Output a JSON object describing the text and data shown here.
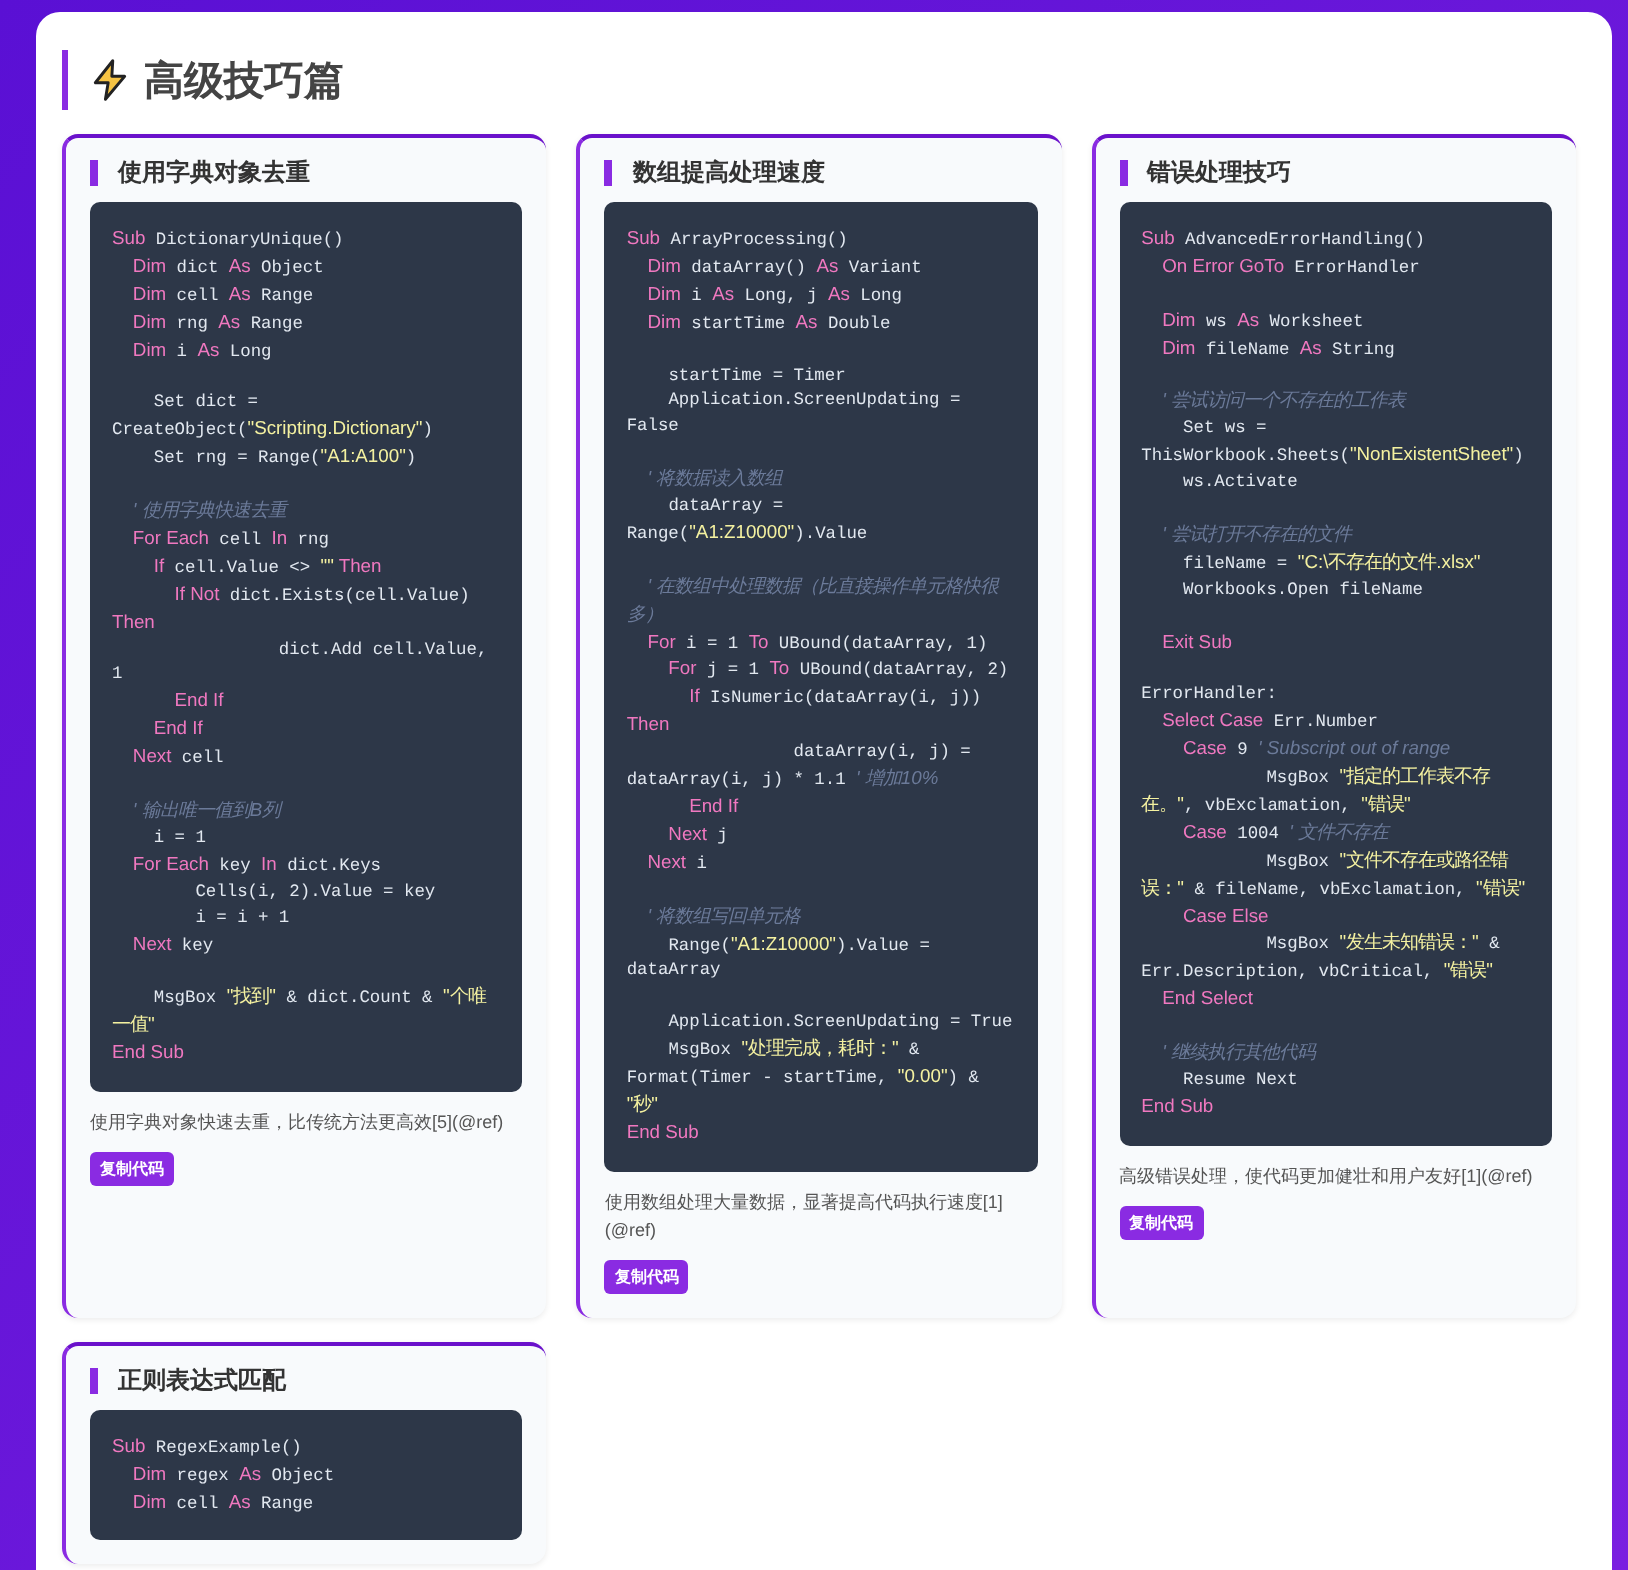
{
  "section": {
    "title": "高级技巧篇"
  },
  "cards": [
    {
      "title": "使用字典对象去重",
      "code": [
        {
          "kind": "code",
          "tokens": [
            {
              "kind": "kw",
              "text": "Sub"
            },
            {
              "kind": "text",
              "text": " DictionaryUnique()"
            }
          ]
        },
        {
          "kind": "code",
          "tokens": [
            {
              "kind": "kw",
              "text": "    Dim"
            },
            {
              "kind": "text",
              "text": " dict "
            },
            {
              "kind": "kw",
              "text": "As"
            },
            {
              "kind": "text",
              "text": " Object"
            }
          ]
        },
        {
          "kind": "code",
          "tokens": [
            {
              "kind": "kw",
              "text": "    Dim"
            },
            {
              "kind": "text",
              "text": " cell "
            },
            {
              "kind": "kw",
              "text": "As"
            },
            {
              "kind": "text",
              "text": " Range"
            }
          ]
        },
        {
          "kind": "code",
          "tokens": [
            {
              "kind": "kw",
              "text": "    Dim"
            },
            {
              "kind": "text",
              "text": " rng "
            },
            {
              "kind": "kw",
              "text": "As"
            },
            {
              "kind": "text",
              "text": " Range"
            }
          ]
        },
        {
          "kind": "code",
          "tokens": [
            {
              "kind": "kw",
              "text": "    Dim"
            },
            {
              "kind": "text",
              "text": " i "
            },
            {
              "kind": "kw",
              "text": "As"
            },
            {
              "kind": "text",
              "text": " Long"
            }
          ]
        },
        {
          "kind": "blank"
        },
        {
          "kind": "code",
          "tokens": [
            {
              "kind": "text",
              "text": "    Set dict = CreateObject("
            },
            {
              "kind": "str",
              "text": "\"Scripting.Dictionary\""
            },
            {
              "kind": "text",
              "text": ")"
            }
          ]
        },
        {
          "kind": "code",
          "tokens": [
            {
              "kind": "text",
              "text": "    Set rng = Range("
            },
            {
              "kind": "str",
              "text": "\"A1:A100\""
            },
            {
              "kind": "text",
              "text": ")"
            }
          ]
        },
        {
          "kind": "blank"
        },
        {
          "kind": "code",
          "tokens": [
            {
              "kind": "comment",
              "text": "    ' 使用字典快速去重"
            }
          ]
        },
        {
          "kind": "code",
          "tokens": [
            {
              "kind": "kw",
              "text": "    For Each"
            },
            {
              "kind": "text",
              "text": " cell "
            },
            {
              "kind": "kw",
              "text": "In"
            },
            {
              "kind": "text",
              "text": " rng"
            }
          ]
        },
        {
          "kind": "code",
          "tokens": [
            {
              "kind": "kw",
              "text": "        If"
            },
            {
              "kind": "text",
              "text": " cell.Value <> "
            },
            {
              "kind": "str",
              "text": "\"\""
            },
            {
              "kind": "kw",
              "text": " Then"
            }
          ]
        },
        {
          "kind": "code",
          "tokens": [
            {
              "kind": "kw",
              "text": "            If Not"
            },
            {
              "kind": "text",
              "text": " dict.Exists(cell.Value) "
            },
            {
              "kind": "kw",
              "text": "Then"
            }
          ]
        },
        {
          "kind": "code",
          "tokens": [
            {
              "kind": "text",
              "text": "                dict.Add cell.Value, 1"
            }
          ]
        },
        {
          "kind": "code",
          "tokens": [
            {
              "kind": "kw",
              "text": "            End If"
            }
          ]
        },
        {
          "kind": "code",
          "tokens": [
            {
              "kind": "kw",
              "text": "        End If"
            }
          ]
        },
        {
          "kind": "code",
          "tokens": [
            {
              "kind": "kw",
              "text": "    Next"
            },
            {
              "kind": "text",
              "text": " cell"
            }
          ]
        },
        {
          "kind": "blank"
        },
        {
          "kind": "code",
          "tokens": [
            {
              "kind": "comment",
              "text": "    ' 输出唯一值到B列"
            }
          ]
        },
        {
          "kind": "code",
          "tokens": [
            {
              "kind": "text",
              "text": "    i = 1"
            }
          ]
        },
        {
          "kind": "code",
          "tokens": [
            {
              "kind": "kw",
              "text": "    For Each"
            },
            {
              "kind": "text",
              "text": " key "
            },
            {
              "kind": "kw",
              "text": "In"
            },
            {
              "kind": "text",
              "text": " dict.Keys"
            }
          ]
        },
        {
          "kind": "code",
          "tokens": [
            {
              "kind": "text",
              "text": "        Cells(i, 2).Value = key"
            }
          ]
        },
        {
          "kind": "code",
          "tokens": [
            {
              "kind": "text",
              "text": "        i = i + 1"
            }
          ]
        },
        {
          "kind": "code",
          "tokens": [
            {
              "kind": "kw",
              "text": "    Next"
            },
            {
              "kind": "text",
              "text": " key"
            }
          ]
        },
        {
          "kind": "blank"
        },
        {
          "kind": "code",
          "tokens": [
            {
              "kind": "text",
              "text": "    MsgBox "
            },
            {
              "kind": "str",
              "text": "\"找到\""
            },
            {
              "kind": "text",
              "text": " & dict.Count & "
            },
            {
              "kind": "str",
              "text": "\"个唯一值\""
            }
          ]
        },
        {
          "kind": "code",
          "tokens": [
            {
              "kind": "kw",
              "text": "End Sub"
            }
          ]
        }
      ],
      "description": "使用字典对象快速去重，比传统方法更高效[5](@ref)",
      "button": "复制代码"
    },
    {
      "title": "数组提高处理速度",
      "code": [
        {
          "kind": "code",
          "tokens": [
            {
              "kind": "kw",
              "text": "Sub"
            },
            {
              "kind": "text",
              "text": " ArrayProcessing()"
            }
          ]
        },
        {
          "kind": "code",
          "tokens": [
            {
              "kind": "kw",
              "text": "    Dim"
            },
            {
              "kind": "text",
              "text": " dataArray() "
            },
            {
              "kind": "kw",
              "text": "As"
            },
            {
              "kind": "text",
              "text": " Variant"
            }
          ]
        },
        {
          "kind": "code",
          "tokens": [
            {
              "kind": "kw",
              "text": "    Dim"
            },
            {
              "kind": "text",
              "text": " i "
            },
            {
              "kind": "kw",
              "text": "As"
            },
            {
              "kind": "text",
              "text": " Long, j "
            },
            {
              "kind": "kw",
              "text": "As"
            },
            {
              "kind": "text",
              "text": " Long"
            }
          ]
        },
        {
          "kind": "code",
          "tokens": [
            {
              "kind": "kw",
              "text": "    Dim"
            },
            {
              "kind": "text",
              "text": " startTime "
            },
            {
              "kind": "kw",
              "text": "As"
            },
            {
              "kind": "text",
              "text": " Double"
            }
          ]
        },
        {
          "kind": "blank"
        },
        {
          "kind": "code",
          "tokens": [
            {
              "kind": "text",
              "text": "    startTime = Timer"
            }
          ]
        },
        {
          "kind": "code",
          "tokens": [
            {
              "kind": "text",
              "text": "    Application.ScreenUpdating = False"
            }
          ]
        },
        {
          "kind": "blank"
        },
        {
          "kind": "code",
          "tokens": [
            {
              "kind": "comment",
              "text": "    ' 将数据读入数组"
            }
          ]
        },
        {
          "kind": "code",
          "tokens": [
            {
              "kind": "text",
              "text": "    dataArray = Range("
            },
            {
              "kind": "str",
              "text": "\"A1:Z10000\""
            },
            {
              "kind": "text",
              "text": ").Value"
            }
          ]
        },
        {
          "kind": "blank"
        },
        {
          "kind": "code",
          "tokens": [
            {
              "kind": "comment",
              "text": "    ' 在数组中处理数据（比直接操作单元格快很多）"
            }
          ]
        },
        {
          "kind": "code",
          "tokens": [
            {
              "kind": "kw",
              "text": "    For"
            },
            {
              "kind": "text",
              "text": " i = 1 "
            },
            {
              "kind": "kw",
              "text": "To"
            },
            {
              "kind": "text",
              "text": " UBound(dataArray, 1)"
            }
          ]
        },
        {
          "kind": "code",
          "tokens": [
            {
              "kind": "kw",
              "text": "        For"
            },
            {
              "kind": "text",
              "text": " j = 1 "
            },
            {
              "kind": "kw",
              "text": "To"
            },
            {
              "kind": "text",
              "text": " UBound(dataArray, 2)"
            }
          ]
        },
        {
          "kind": "code",
          "tokens": [
            {
              "kind": "kw",
              "text": "            If"
            },
            {
              "kind": "text",
              "text": " IsNumeric(dataArray(i, j)) "
            },
            {
              "kind": "kw",
              "text": "Then"
            }
          ]
        },
        {
          "kind": "code",
          "tokens": [
            {
              "kind": "text",
              "text": "                dataArray(i, j) = dataArray(i, j) * 1.1 "
            },
            {
              "kind": "comment",
              "text": "' 增加10%"
            }
          ]
        },
        {
          "kind": "code",
          "tokens": [
            {
              "kind": "kw",
              "text": "            End If"
            }
          ]
        },
        {
          "kind": "code",
          "tokens": [
            {
              "kind": "kw",
              "text": "        Next"
            },
            {
              "kind": "text",
              "text": " j"
            }
          ]
        },
        {
          "kind": "code",
          "tokens": [
            {
              "kind": "kw",
              "text": "    Next"
            },
            {
              "kind": "text",
              "text": " i"
            }
          ]
        },
        {
          "kind": "blank"
        },
        {
          "kind": "code",
          "tokens": [
            {
              "kind": "comment",
              "text": "    ' 将数组写回单元格"
            }
          ]
        },
        {
          "kind": "code",
          "tokens": [
            {
              "kind": "text",
              "text": "    Range("
            },
            {
              "kind": "str",
              "text": "\"A1:Z10000\""
            },
            {
              "kind": "text",
              "text": ").Value = dataArray"
            }
          ]
        },
        {
          "kind": "blank"
        },
        {
          "kind": "code",
          "tokens": [
            {
              "kind": "text",
              "text": "    Application.ScreenUpdating = True"
            }
          ]
        },
        {
          "kind": "code",
          "tokens": [
            {
              "kind": "text",
              "text": "    MsgBox "
            },
            {
              "kind": "str",
              "text": "\"处理完成，耗时：\""
            },
            {
              "kind": "text",
              "text": " & Format(Timer - startTime, "
            },
            {
              "kind": "str",
              "text": "\"0.00\""
            },
            {
              "kind": "text",
              "text": ") & "
            },
            {
              "kind": "str",
              "text": "\"秒\""
            }
          ]
        },
        {
          "kind": "code",
          "tokens": [
            {
              "kind": "kw",
              "text": "End Sub"
            }
          ]
        }
      ],
      "description": "使用数组处理大量数据，显著提高代码执行速度[1](@ref)",
      "button": "复制代码"
    },
    {
      "title": "错误处理技巧",
      "code": [
        {
          "kind": "code",
          "tokens": [
            {
              "kind": "kw",
              "text": "Sub"
            },
            {
              "kind": "text",
              "text": " AdvancedErrorHandling()"
            }
          ]
        },
        {
          "kind": "code",
          "tokens": [
            {
              "kind": "kw",
              "text": "    On Error GoTo"
            },
            {
              "kind": "text",
              "text": " ErrorHandler"
            }
          ]
        },
        {
          "kind": "blank"
        },
        {
          "kind": "code",
          "tokens": [
            {
              "kind": "kw",
              "text": "    Dim"
            },
            {
              "kind": "text",
              "text": " ws "
            },
            {
              "kind": "kw",
              "text": "As"
            },
            {
              "kind": "text",
              "text": " Worksheet"
            }
          ]
        },
        {
          "kind": "code",
          "tokens": [
            {
              "kind": "kw",
              "text": "    Dim"
            },
            {
              "kind": "text",
              "text": " fileName "
            },
            {
              "kind": "kw",
              "text": "As"
            },
            {
              "kind": "text",
              "text": " String"
            }
          ]
        },
        {
          "kind": "blank"
        },
        {
          "kind": "code",
          "tokens": [
            {
              "kind": "comment",
              "text": "    ' 尝试访问一个不存在的工作表"
            }
          ]
        },
        {
          "kind": "code",
          "tokens": [
            {
              "kind": "text",
              "text": "    Set ws = ThisWorkbook.Sheets("
            },
            {
              "kind": "str",
              "text": "\"NonExistentSheet\""
            },
            {
              "kind": "text",
              "text": ")"
            }
          ]
        },
        {
          "kind": "code",
          "tokens": [
            {
              "kind": "text",
              "text": "    ws.Activate"
            }
          ]
        },
        {
          "kind": "blank"
        },
        {
          "kind": "code",
          "tokens": [
            {
              "kind": "comment",
              "text": "    ' 尝试打开不存在的文件"
            }
          ]
        },
        {
          "kind": "code",
          "tokens": [
            {
              "kind": "text",
              "text": "    fileName = "
            },
            {
              "kind": "str",
              "text": "\"C:\\不存在的文件.xlsx\""
            }
          ]
        },
        {
          "kind": "code",
          "tokens": [
            {
              "kind": "text",
              "text": "    Workbooks.Open fileName"
            }
          ]
        },
        {
          "kind": "blank"
        },
        {
          "kind": "code",
          "tokens": [
            {
              "kind": "kw",
              "text": "    Exit Sub"
            }
          ]
        },
        {
          "kind": "blank"
        },
        {
          "kind": "code",
          "tokens": [
            {
              "kind": "text",
              "text": "ErrorHandler:"
            }
          ]
        },
        {
          "kind": "code",
          "tokens": [
            {
              "kind": "kw",
              "text": "    Select Case"
            },
            {
              "kind": "text",
              "text": " Err.Number"
            }
          ]
        },
        {
          "kind": "code",
          "tokens": [
            {
              "kind": "kw",
              "text": "        Case"
            },
            {
              "kind": "text",
              "text": " 9 "
            },
            {
              "kind": "comment",
              "text": "' Subscript out of range"
            }
          ]
        },
        {
          "kind": "code",
          "tokens": [
            {
              "kind": "text",
              "text": "            MsgBox "
            },
            {
              "kind": "str",
              "text": "\"指定的工作表不存在。\""
            },
            {
              "kind": "text",
              "text": ", vbExclamation, "
            },
            {
              "kind": "str",
              "text": "\"错误\""
            }
          ]
        },
        {
          "kind": "code",
          "tokens": [
            {
              "kind": "kw",
              "text": "        Case"
            },
            {
              "kind": "text",
              "text": " 1004 "
            },
            {
              "kind": "comment",
              "text": "' 文件不存在"
            }
          ]
        },
        {
          "kind": "code",
          "tokens": [
            {
              "kind": "text",
              "text": "            MsgBox "
            },
            {
              "kind": "str",
              "text": "\"文件不存在或路径错误：\""
            },
            {
              "kind": "text",
              "text": " & fileName, vbExclamation, "
            },
            {
              "kind": "str",
              "text": "\"错误\""
            }
          ]
        },
        {
          "kind": "code",
          "tokens": [
            {
              "kind": "kw",
              "text": "        Case Else"
            }
          ]
        },
        {
          "kind": "code",
          "tokens": [
            {
              "kind": "text",
              "text": "            MsgBox "
            },
            {
              "kind": "str",
              "text": "\"发生未知错误：\""
            },
            {
              "kind": "text",
              "text": " & Err.Description, vbCritical, "
            },
            {
              "kind": "str",
              "text": "\"错误\""
            }
          ]
        },
        {
          "kind": "code",
          "tokens": [
            {
              "kind": "kw",
              "text": "    End Select"
            }
          ]
        },
        {
          "kind": "blank"
        },
        {
          "kind": "code",
          "tokens": [
            {
              "kind": "comment",
              "text": "    ' 继续执行其他代码"
            }
          ]
        },
        {
          "kind": "code",
          "tokens": [
            {
              "kind": "text",
              "text": "    Resume Next"
            }
          ]
        },
        {
          "kind": "code",
          "tokens": [
            {
              "kind": "kw",
              "text": "End Sub"
            }
          ]
        }
      ],
      "description": "高级错误处理，使代码更加健壮和用户友好[1](@ref)",
      "button": "复制代码"
    },
    {
      "title": "正则表达式匹配",
      "code": [
        {
          "kind": "code",
          "tokens": [
            {
              "kind": "kw",
              "text": "Sub"
            },
            {
              "kind": "text",
              "text": " RegexExample()"
            }
          ]
        },
        {
          "kind": "code",
          "tokens": [
            {
              "kind": "kw",
              "text": "    Dim"
            },
            {
              "kind": "text",
              "text": " regex "
            },
            {
              "kind": "kw",
              "text": "As"
            },
            {
              "kind": "text",
              "text": " Object"
            }
          ]
        },
        {
          "kind": "code",
          "tokens": [
            {
              "kind": "kw",
              "text": "    Dim"
            },
            {
              "kind": "text",
              "text": " cell "
            },
            {
              "kind": "kw",
              "text": "As"
            },
            {
              "kind": "text",
              "text": " Range"
            }
          ]
        }
      ]
    }
  ]
}
